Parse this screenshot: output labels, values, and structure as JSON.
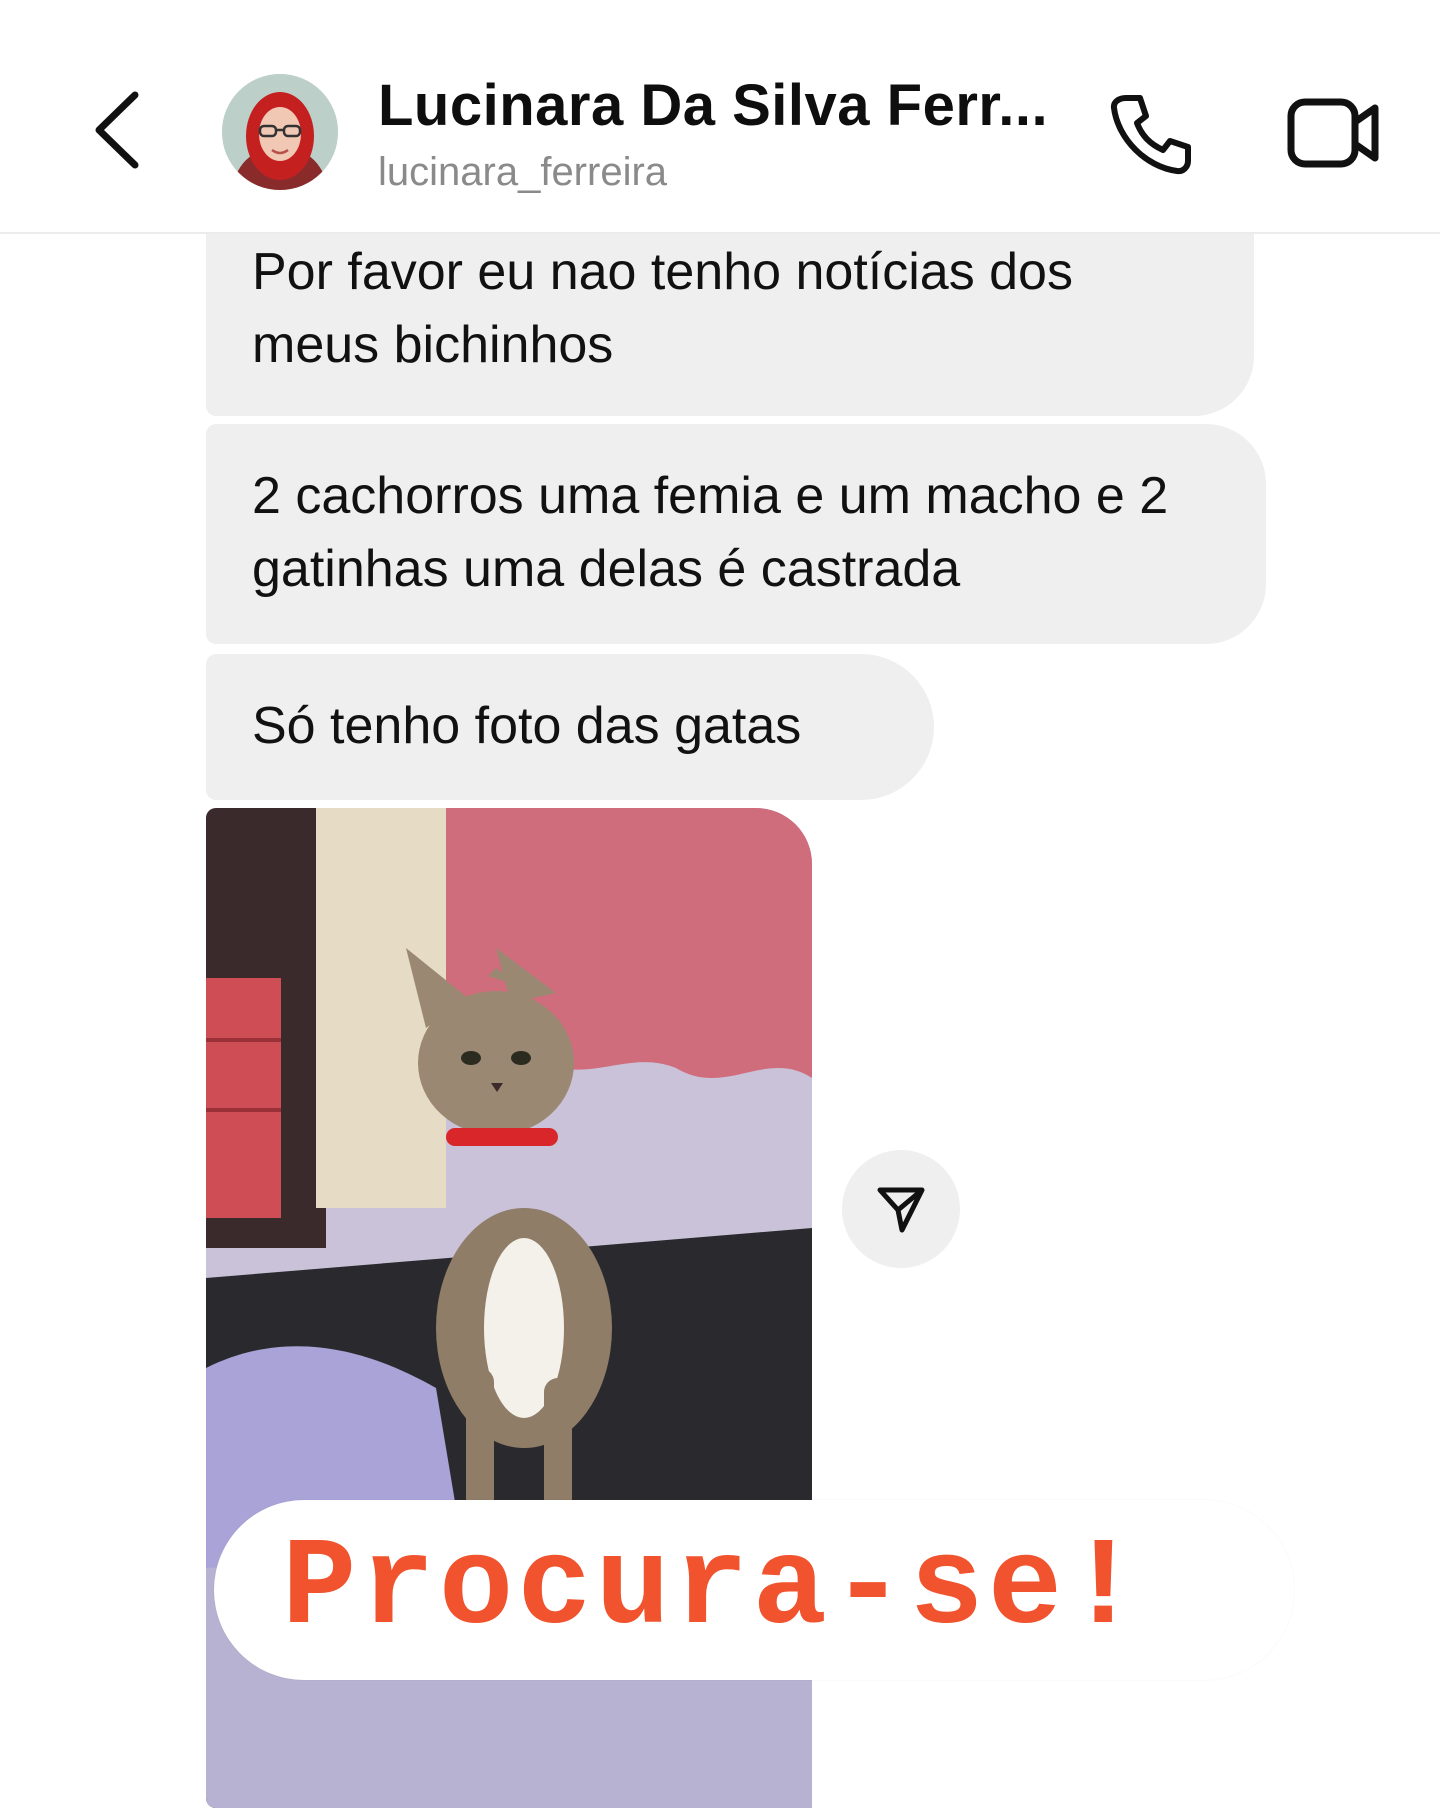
{
  "header": {
    "back_icon": "chevron-left-icon",
    "avatar_alt": "profile photo",
    "name": "Lucinara Da Silva Ferr...",
    "username": "lucinara_ferreira",
    "call_icon": "phone-icon",
    "video_icon": "video-camera-icon"
  },
  "messages": [
    {
      "text": "Por favor eu nao tenho notícias dos meus bichinhos"
    },
    {
      "text": "2 cachorros uma femia e um macho e 2 gatinhas uma delas é castrada"
    },
    {
      "text": "Só tenho foto das gatas"
    }
  ],
  "photo": {
    "subject": "tabby cat with red collar"
  },
  "share_icon": "send-icon",
  "sticker": {
    "text": "Procura-se!",
    "color": "#f0532d"
  },
  "colors": {
    "bubble_bg": "#efefef",
    "accent": "#f0532d",
    "muted_text": "#8a8a8a"
  }
}
